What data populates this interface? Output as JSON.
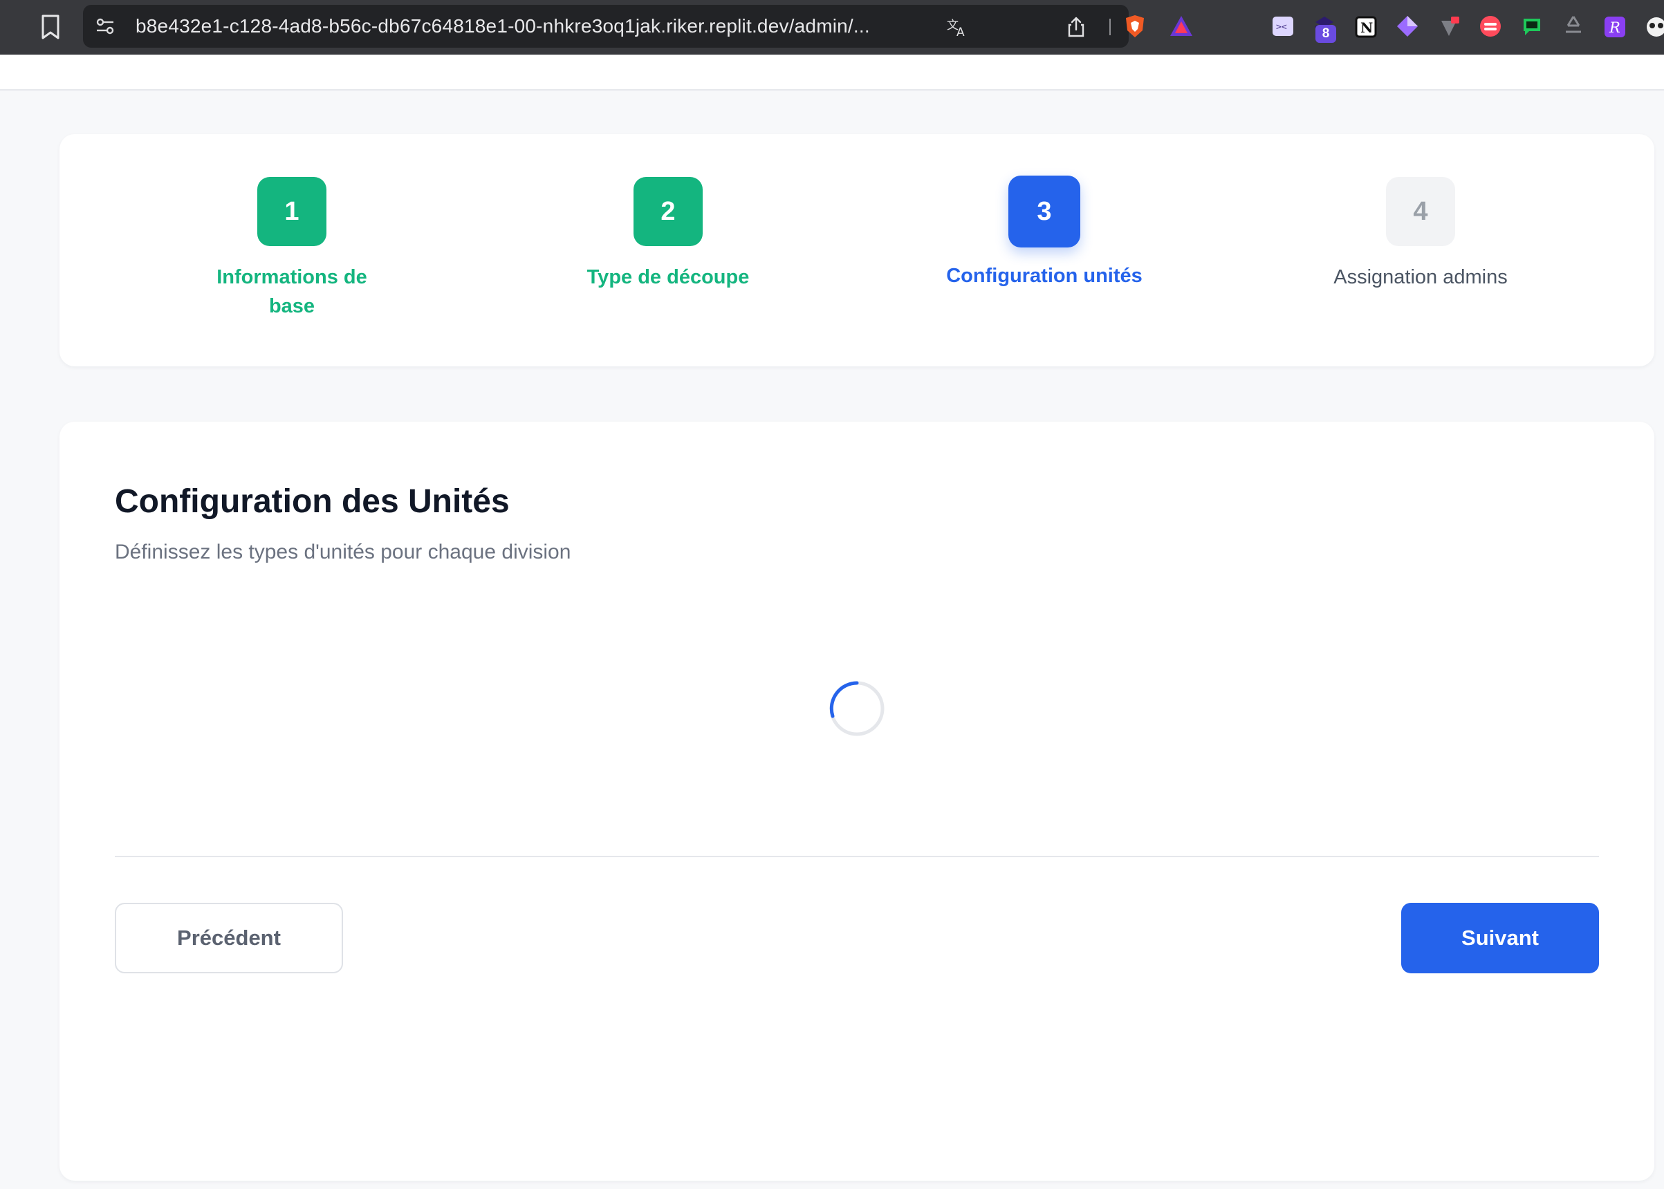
{
  "browser": {
    "url": "b8e432e1-c128-4ad8-b56c-db67c64818e1-00-nhkre3oq1jak.riker.replit.dev/admin/...",
    "extension_badge": "8",
    "icons": [
      "bookmark-icon",
      "site-settings-icon",
      "translate-icon",
      "share-icon",
      "brave-shield-icon",
      "brave-rewards-icon",
      "extension-icons"
    ]
  },
  "stepper": {
    "steps": [
      {
        "number": "1",
        "label": "Informations de base",
        "state": "done"
      },
      {
        "number": "2",
        "label": "Type de découpe",
        "state": "done"
      },
      {
        "number": "3",
        "label": "Configuration unités",
        "state": "active"
      },
      {
        "number": "4",
        "label": "Assignation admins",
        "state": "pending"
      }
    ]
  },
  "main": {
    "title": "Configuration des Unités",
    "subtitle": "Définissez les types d'unités pour chaque division",
    "loading": true,
    "prev_label": "Précédent",
    "next_label": "Suivant"
  },
  "colors": {
    "done": "#14b57f",
    "active": "#2563eb",
    "pending_bg": "#f2f3f5",
    "chrome_bg": "#38393d"
  }
}
